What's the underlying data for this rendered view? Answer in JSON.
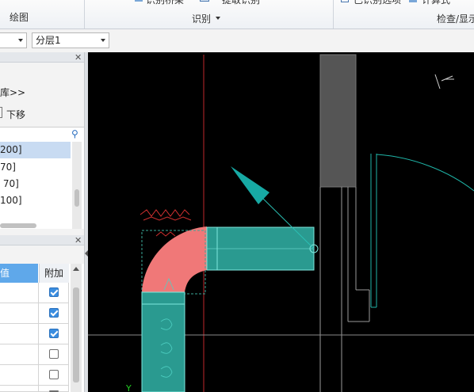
{
  "ribbon": {
    "draw_group": "绘图",
    "identify_btn1": "识别桥架",
    "identify_btn2": "提取识别",
    "identify_group": "识别",
    "check_btn1": "已识别选项",
    "check_btn2": "计算式",
    "check_group": "检查/显示"
  },
  "toolbar": {
    "combo1_value": "",
    "floor_combo_value": "分层1"
  },
  "library_panel": {
    "library_link": "库>>",
    "move_down": "下移",
    "items": [
      "200]",
      "70]",
      " 70]",
      "100]"
    ]
  },
  "props_panel": {
    "col_value": "值",
    "col_attach": "附加",
    "rows": [
      {
        "attach": true
      },
      {
        "attach": true
      },
      {
        "attach": true
      },
      {
        "attach": false
      },
      {
        "attach": false
      },
      {
        "attach": false
      }
    ]
  },
  "colors": {
    "duct": "#2a9a90",
    "elbow": "#f07878",
    "canvas_bg": "#000000",
    "axis_red": "#c0282c"
  }
}
